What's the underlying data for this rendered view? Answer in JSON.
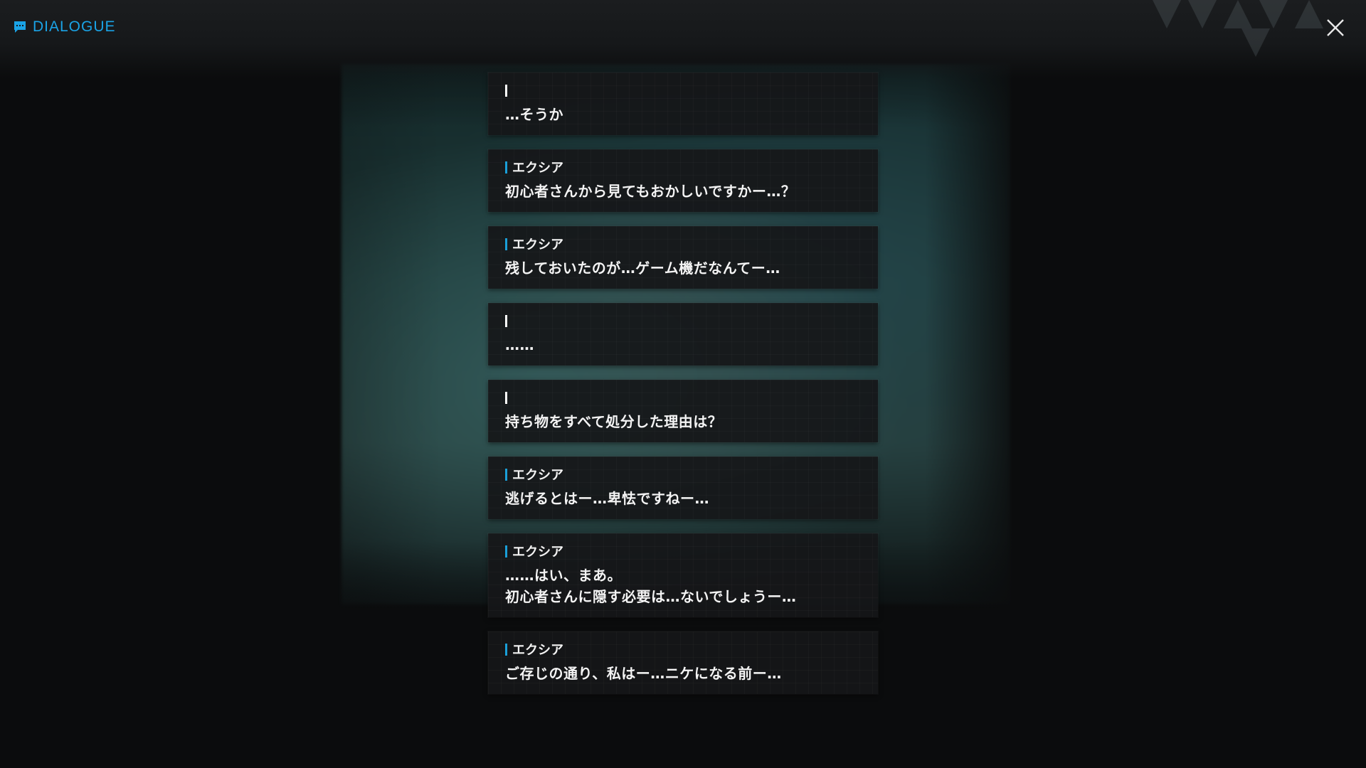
{
  "header": {
    "icon": "chat-bubble-icon",
    "title": "DIALOGUE",
    "accent_color": "#1aa3e6"
  },
  "close_button": {
    "icon": "close-icon"
  },
  "dialogue": [
    {
      "speaker": "",
      "is_player": true,
      "text": "…そうか"
    },
    {
      "speaker": "エクシア",
      "is_player": false,
      "text": "初心者さんから見てもおかしいですかー…？"
    },
    {
      "speaker": "エクシア",
      "is_player": false,
      "text": "残しておいたのが…ゲーム機だなんてー…"
    },
    {
      "speaker": "",
      "is_player": true,
      "text": "……"
    },
    {
      "speaker": "",
      "is_player": true,
      "text": "持ち物をすべて処分した理由は？"
    },
    {
      "speaker": "エクシア",
      "is_player": false,
      "text": "逃げるとはー…卑怯ですねー…"
    },
    {
      "speaker": "エクシア",
      "is_player": false,
      "text": "……はい、まあ。\n初心者さんに隠す必要は…ないでしょうー…"
    },
    {
      "speaker": "エクシア",
      "is_player": false,
      "text": "ご存じの通り、私はー…ニケになる前ー…"
    }
  ]
}
